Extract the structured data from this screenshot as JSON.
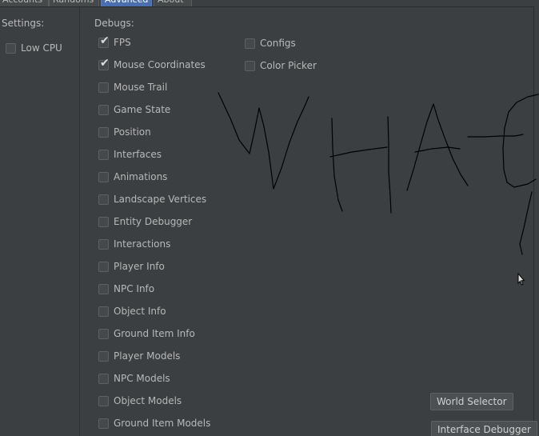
{
  "tabs": [
    {
      "label": "Accounts"
    },
    {
      "label": "Randoms"
    },
    {
      "label": "Advanced"
    },
    {
      "label": "About"
    }
  ],
  "settings": {
    "label": "Settings:",
    "low_cpu": {
      "label": "Low CPU",
      "checked": false
    }
  },
  "debugs": {
    "label": "Debugs:",
    "column1": [
      {
        "label": "FPS",
        "checked": true
      },
      {
        "label": "Mouse Coordinates",
        "checked": true
      },
      {
        "label": "Mouse Trail",
        "checked": false
      },
      {
        "label": "Game State",
        "checked": false
      },
      {
        "label": "Position",
        "checked": false
      },
      {
        "label": "Interfaces",
        "checked": false
      },
      {
        "label": "Animations",
        "checked": false
      },
      {
        "label": "Landscape Vertices",
        "checked": false
      },
      {
        "label": "Entity Debugger",
        "checked": false
      },
      {
        "label": "Interactions",
        "checked": false
      },
      {
        "label": "Player Info",
        "checked": false
      },
      {
        "label": "NPC Info",
        "checked": false
      },
      {
        "label": "Object Info",
        "checked": false
      },
      {
        "label": "Ground Item Info",
        "checked": false
      },
      {
        "label": "Player Models",
        "checked": false
      },
      {
        "label": "NPC Models",
        "checked": false
      },
      {
        "label": "Object Models",
        "checked": false
      },
      {
        "label": "Ground Item Models",
        "checked": false
      }
    ],
    "column2": [
      {
        "label": "Configs",
        "checked": false
      },
      {
        "label": "Color Picker",
        "checked": false
      }
    ]
  },
  "buttons": {
    "world_selector": "World Selector",
    "interface_debugger": "Interface Debugger"
  },
  "colors": {
    "background": "#3c3f41",
    "text": "#b8b8b8",
    "active_tab": "#4b6eaf",
    "drawing_stroke": "#000000"
  }
}
